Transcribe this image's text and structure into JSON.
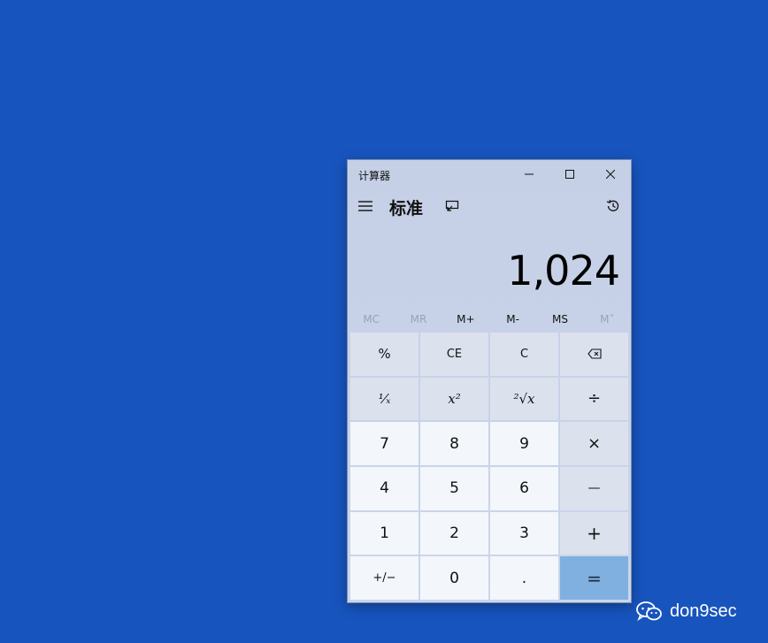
{
  "window": {
    "title": "计算器",
    "mode": "标准"
  },
  "display": {
    "value": "1,024"
  },
  "memory": [
    {
      "label": "MC",
      "enabled": false
    },
    {
      "label": "MR",
      "enabled": false
    },
    {
      "label": "M+",
      "enabled": true
    },
    {
      "label": "M-",
      "enabled": true
    },
    {
      "label": "MS",
      "enabled": true
    },
    {
      "label": "M˅",
      "enabled": false
    }
  ],
  "keys": {
    "percent": "%",
    "ce": "CE",
    "c": "C",
    "backspace_icon": "backspace-icon",
    "reciprocal": "¹⁄ₓ",
    "square": "x²",
    "sqrt": "²√x",
    "divide": "÷",
    "seven": "7",
    "eight": "8",
    "nine": "9",
    "multiply": "×",
    "four": "4",
    "five": "5",
    "six": "6",
    "minus": "—",
    "one": "1",
    "two": "2",
    "three": "3",
    "plus": "+",
    "negate": "+/−",
    "zero": "0",
    "decimal": ".",
    "equals": "="
  },
  "watermark": {
    "text": "don9sec",
    "icon": "wechat-icon"
  },
  "colors": {
    "desktop": "#1754bd",
    "equals_accent": "#7fb0df"
  }
}
